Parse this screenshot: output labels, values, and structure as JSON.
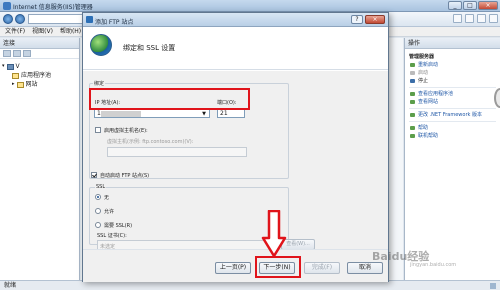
{
  "window": {
    "title": "Internet 信息服务(IIS)管理器",
    "controls": {
      "minimize": "_",
      "maximize": "□",
      "close": "×"
    }
  },
  "menu": [
    "文件(F)",
    "视图(V)",
    "帮助(H)"
  ],
  "connections": {
    "title": "连接",
    "tree": [
      {
        "label": "V",
        "icon": "server-icon"
      },
      {
        "label": "应用程序池",
        "icon": "app-pool-icon"
      },
      {
        "label": "网站",
        "icon": "sites-icon"
      }
    ]
  },
  "actions": {
    "title": "操作",
    "sections": [
      {
        "heading": "管理服务器",
        "items": [
          {
            "label": "重新启动",
            "state": "enabled"
          },
          {
            "label": "启动",
            "state": "disabled"
          },
          {
            "label": "停止",
            "state": "plain"
          }
        ]
      },
      {
        "heading": "",
        "items": [
          {
            "label": "查看应用程序池",
            "state": "enabled"
          },
          {
            "label": "查看网站",
            "state": "enabled"
          }
        ]
      },
      {
        "heading": "",
        "items": [
          {
            "label": "更改 .NET Framework 版本",
            "state": "enabled"
          }
        ]
      },
      {
        "heading": "",
        "items": [
          {
            "label": "帮助",
            "state": "enabled"
          },
          {
            "label": "联机帮助",
            "state": "enabled"
          }
        ]
      }
    ]
  },
  "status": {
    "text": "就绪"
  },
  "dialog": {
    "title": "添加 FTP 站点",
    "help": "?",
    "close": "×",
    "heading": "绑定和 SSL 设置",
    "binding": {
      "group_label": "绑定",
      "ip_label": "IP 地址(A):",
      "ip_value": "1",
      "ip_arrow": "▼",
      "port_label": "端口(O):",
      "port_value": "21",
      "virtual_host_checkbox": "启用虚拟主机名(E):",
      "virtual_host_label": "虚拟主机(示例: ftp.contoso.com)(V):",
      "virtual_host_value": ""
    },
    "autostart": {
      "label": "自动启动 FTP 站点(S)",
      "checked": true
    },
    "ssl": {
      "group_label": "SSL",
      "options": [
        {
          "label": "无",
          "selected": true
        },
        {
          "label": "允许",
          "selected": false
        },
        {
          "label": "需要 SSL(R)",
          "selected": false
        }
      ],
      "cert_label": "SSL 证书(C):",
      "cert_value": "未选定",
      "view_button": "查看(W)..."
    },
    "buttons": {
      "prev": "上一页(P)",
      "next": "下一步(N)",
      "finish": "完成(F)",
      "cancel": "取消"
    }
  },
  "watermark": {
    "main": "Baidu经验",
    "sub": "jingyan.baidu.com"
  }
}
